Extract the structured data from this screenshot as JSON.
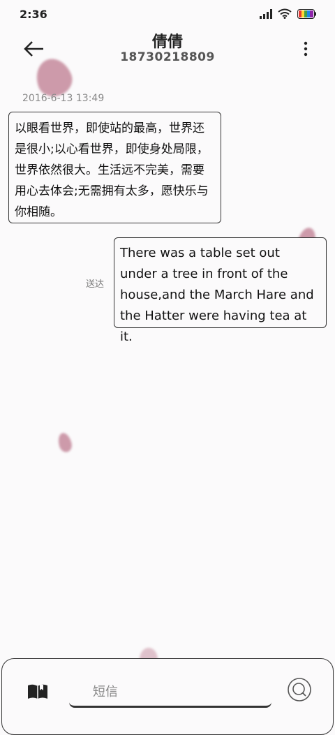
{
  "status_bar": {
    "time": "2:36"
  },
  "header": {
    "contact_name": "倩倩",
    "contact_number": "18730218809"
  },
  "conversation": {
    "timestamp": "2016-6-13 13:49",
    "messages": [
      {
        "direction": "incoming",
        "text": "以眼看世界，即使站的最高，世界还是很小;以心看世界，即使身处局限，世界依然很大。生活远不完美，需要用心去体会;无需拥有太多，愿快乐与你相随。"
      },
      {
        "direction": "outgoing",
        "text": "There was a table set out under a tree in front of the house,and the March Hare and the Hatter were having tea at it.",
        "status": "送达"
      }
    ]
  },
  "compose": {
    "placeholder": "短信"
  },
  "colors": {
    "background": "#fbfafb",
    "petal": "#c58a9c",
    "border": "#333333"
  }
}
